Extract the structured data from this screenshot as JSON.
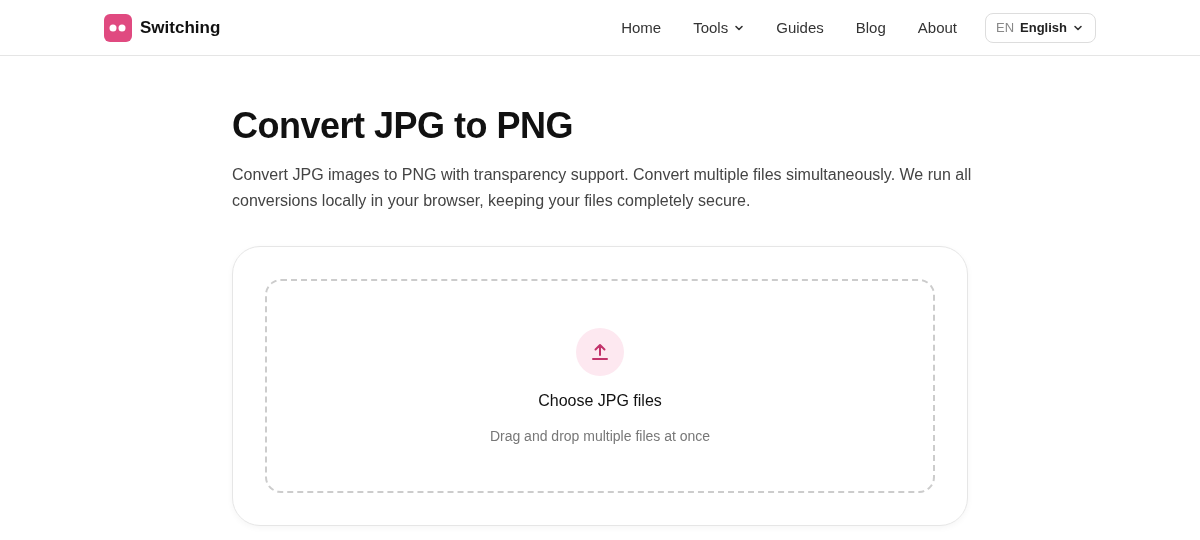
{
  "header": {
    "brand": "Switching",
    "nav": [
      {
        "label": "Home",
        "kind": "link"
      },
      {
        "label": "Tools",
        "kind": "dropdown"
      },
      {
        "label": "Guides",
        "kind": "link"
      },
      {
        "label": "Blog",
        "kind": "link"
      },
      {
        "label": "About",
        "kind": "link"
      }
    ],
    "language": {
      "code": "EN",
      "name": "English"
    }
  },
  "main": {
    "title": "Convert JPG to PNG",
    "description": "Convert JPG images to PNG with transparency support. Convert multiple files simultaneously. We run all conversions locally in your browser, keeping your files completely secure.",
    "dropzone": {
      "label": "Choose JPG files",
      "hint": "Drag and drop multiple files at once"
    }
  }
}
